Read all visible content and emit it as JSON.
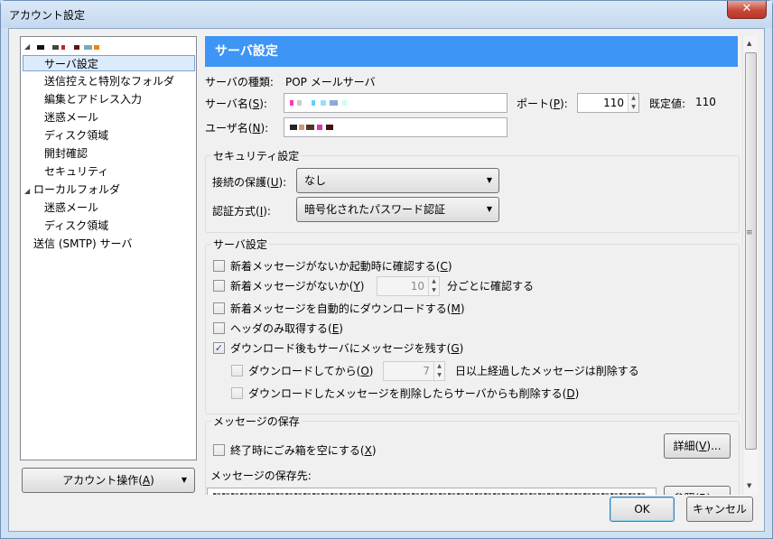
{
  "window": {
    "title": "アカウント設定",
    "close_glyph": "✕"
  },
  "tree": {
    "items": [
      {
        "label": "送信控えと特別なフォルダ"
      },
      {
        "label": "編集とアドレス入力"
      },
      {
        "label": "迷惑メール"
      },
      {
        "label": "ディスク領域"
      },
      {
        "label": "開封確認"
      },
      {
        "label": "セキュリティ"
      },
      {
        "label": "ローカルフォルダ"
      },
      {
        "label": "迷惑メール"
      },
      {
        "label": "ディスク領域"
      },
      {
        "label": "送信 (SMTP) サーバ"
      }
    ],
    "selected": "サーバ設定"
  },
  "account_actions": {
    "label": "アカウント操作(",
    "key": "A",
    "tail": ")"
  },
  "header": {
    "title": "サーバ設定"
  },
  "server": {
    "type_label": "サーバの種類:",
    "type_value": "POP メールサーバ",
    "name_label": {
      "pre": "サーバ名(",
      "key": "S",
      "post": "):"
    },
    "port_label": {
      "pre": "ポート(",
      "key": "P",
      "post": "):"
    },
    "port_value": "110",
    "default_label": "既定値:",
    "default_value": "110",
    "user_label": {
      "pre": "ユーザ名(",
      "key": "N",
      "post": "):"
    }
  },
  "security": {
    "legend": "セキュリティ設定",
    "conn_label": {
      "pre": "接続の保護(",
      "key": "U",
      "post": "):"
    },
    "conn_value": "なし",
    "auth_label": {
      "pre": "認証方式(",
      "key": "I",
      "post": "):"
    },
    "auth_value": "暗号化されたパスワード認証"
  },
  "server_settings": {
    "legend": "サーバ設定",
    "opt1": {
      "pre": "新着メッセージがないか起動時に確認する(",
      "key": "C",
      "post": ")"
    },
    "opt2": {
      "pre": "新着メッセージがないか(",
      "key": "Y",
      "post": ")"
    },
    "opt2_value": "10",
    "opt2_suffix": "分ごとに確認する",
    "opt3": {
      "pre": "新着メッセージを自動的にダウンロードする(",
      "key": "M",
      "post": ")"
    },
    "opt4": {
      "pre": "ヘッダのみ取得する(",
      "key": "E",
      "post": ")"
    },
    "opt5": {
      "pre": "ダウンロード後もサーバにメッセージを残す(",
      "key": "G",
      "post": ")"
    },
    "opt6": {
      "pre": "ダウンロードしてから(",
      "key": "O",
      "post": ")"
    },
    "opt6_value": "7",
    "opt6_suffix": "日以上経過したメッセージは削除する",
    "opt7": {
      "pre": "ダウンロードしたメッセージを削除したらサーバからも削除する(",
      "key": "D",
      "post": ")"
    },
    "check_glyph": "✓"
  },
  "storage": {
    "legend": "メッセージの保存",
    "empty_trash": {
      "pre": "終了時にごみ箱を空にする(",
      "key": "X",
      "post": ")"
    },
    "details_btn": {
      "pre": "詳細(",
      "key": "V",
      "post": ")..."
    },
    "dest_label": "メッセージの保存先:",
    "browse_btn": "参照(B)..."
  },
  "footer": {
    "ok": "OK",
    "cancel": "キャンセル"
  },
  "colors": {
    "header_bg": "#3d95f5",
    "selection_bg": "#dcebfc"
  }
}
